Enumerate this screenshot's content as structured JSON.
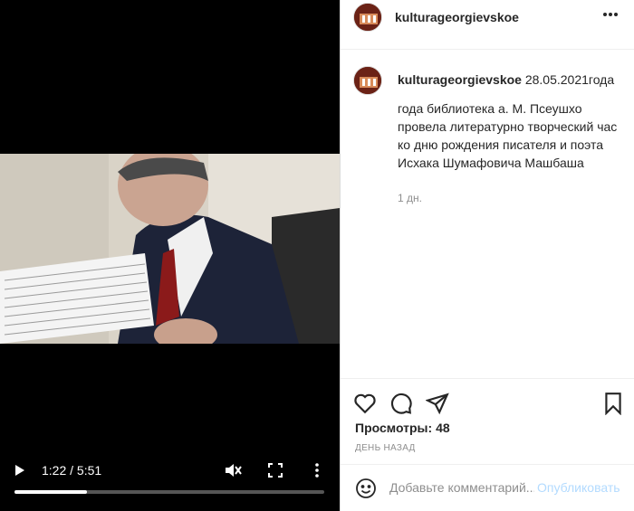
{
  "video": {
    "time_display": "1:22 / 5:51",
    "progress_fraction": 0.234
  },
  "post": {
    "username": "kulturageorgievskoe",
    "caption_user": "kulturageorgievskoe",
    "caption_lead": " 28.05.2021года",
    "caption_body": "года библиотека а. М. Псеушхо провела литературно творческий час ко дню рождения писателя и поэта Исхака Шумафовича Машбаша",
    "caption_age": "1 дн.",
    "views_label": "Просмотры:",
    "views_count": "48",
    "date_text": "ДЕНЬ НАЗАД"
  },
  "comment": {
    "placeholder": "Добавьте комментарий...",
    "post_label": "Опубликовать"
  },
  "colors": {
    "accent": "#0095f6",
    "post_disabled": "#b3dbff",
    "text": "#262626",
    "muted": "#8e8e8e"
  },
  "icons": [
    "play-icon",
    "mute-icon",
    "fullscreen-icon",
    "more-vertical-icon",
    "heart-icon",
    "comment-icon",
    "share-icon",
    "bookmark-icon",
    "emoji-icon",
    "more-horizontal-icon"
  ]
}
